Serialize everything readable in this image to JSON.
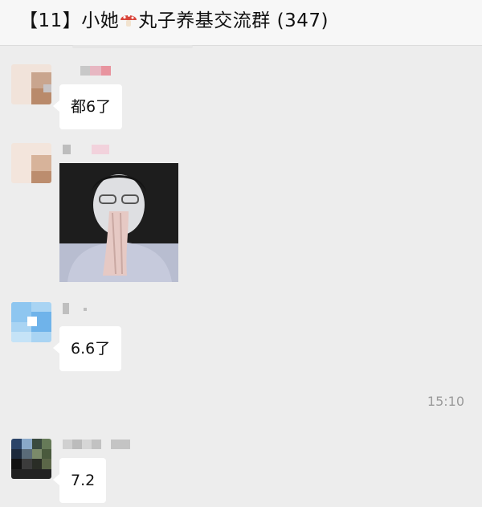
{
  "header": {
    "title_prefix": "【11】小她",
    "title_icon": "mushroom-icon",
    "title_suffix": "丸子养基交流群",
    "member_count": "(347)"
  },
  "messages": [
    {
      "type": "text",
      "text": "都6了"
    },
    {
      "type": "sticker",
      "icon": "reaction-sticker-image"
    },
    {
      "type": "text",
      "text": "6.6了"
    },
    {
      "type": "timestamp",
      "text": "15:10"
    },
    {
      "type": "text",
      "text": "7.2"
    }
  ],
  "colors": {
    "background": "#ededed",
    "bubble": "#ffffff",
    "header": "#f7f7f7",
    "timestamp": "#9a9a9a"
  }
}
